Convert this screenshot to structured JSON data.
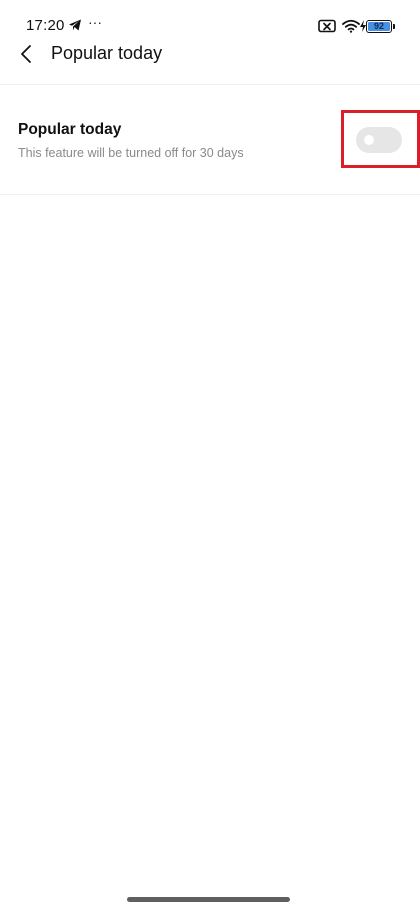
{
  "status_bar": {
    "time": "17:20",
    "more": "···",
    "battery_level": "92",
    "icons": [
      "telegram-send-icon",
      "no-sim-icon",
      "wifi-icon",
      "battery-icon",
      "charging-icon"
    ]
  },
  "header": {
    "title": "Popular today",
    "back_icon": "chevron-left-icon"
  },
  "setting": {
    "title": "Popular today",
    "description": "This feature will be turned off for 30 days",
    "toggle_on": false
  },
  "colors": {
    "highlight": "#d9202a",
    "toggle_off_track": "#e6e6e6",
    "battery_fill": "#4a90e2"
  }
}
